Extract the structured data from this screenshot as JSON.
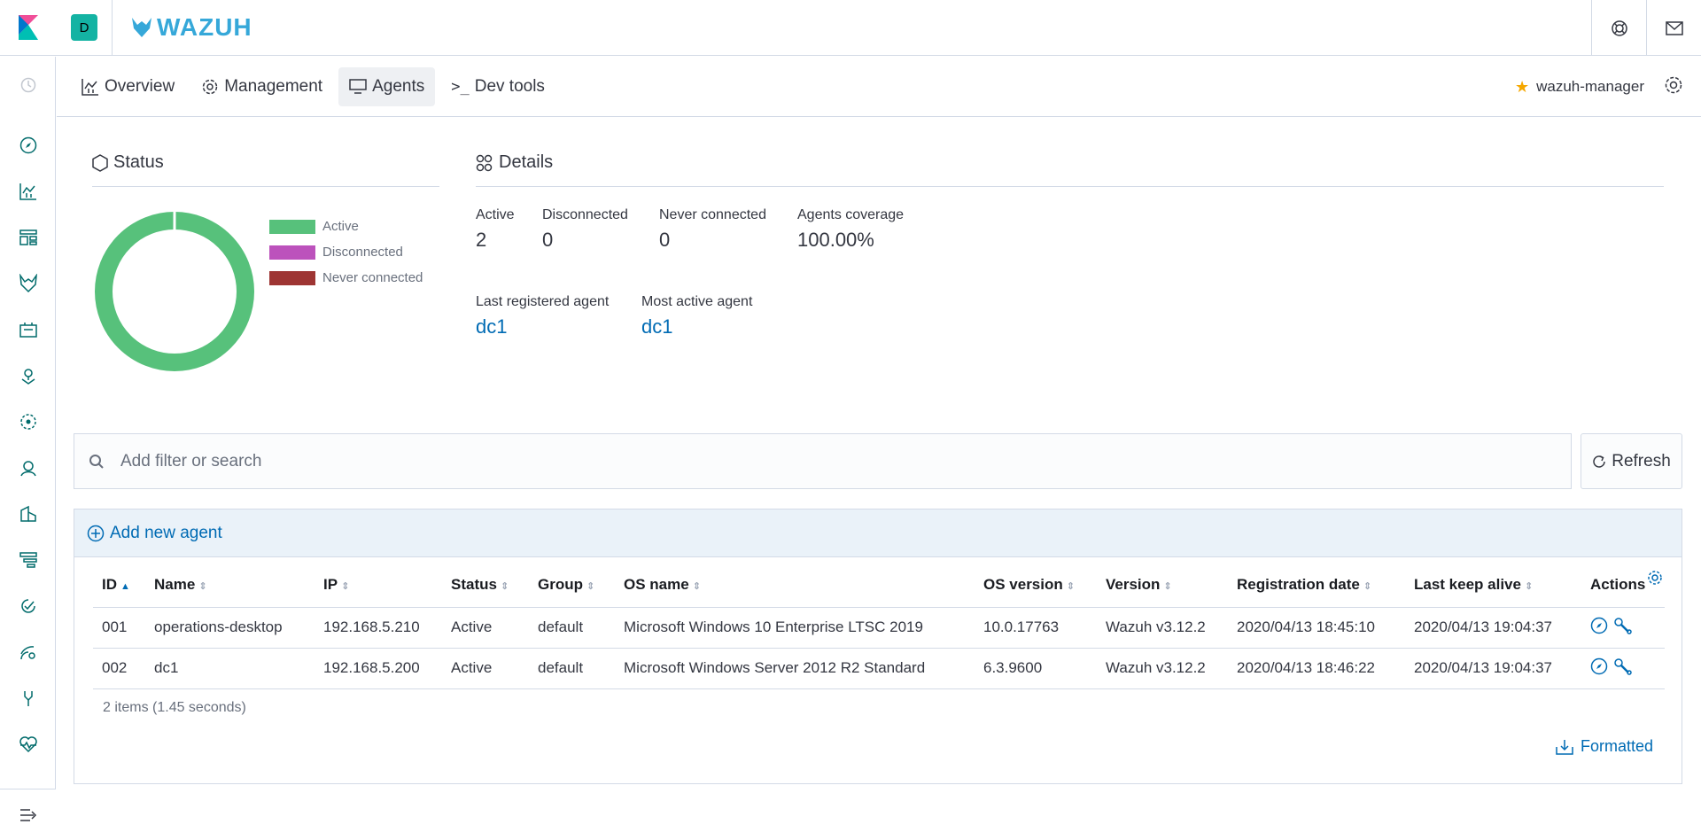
{
  "header": {
    "space_initial": "D",
    "brand": "WAZUH"
  },
  "subnav": {
    "tabs": [
      {
        "label": "Overview",
        "icon": "chart-icon"
      },
      {
        "label": "Management",
        "icon": "gear-icon"
      },
      {
        "label": "Agents",
        "icon": "monitor-icon",
        "active": true
      },
      {
        "label": "Dev tools",
        "icon": "terminal-icon"
      }
    ],
    "manager": "wazuh-manager"
  },
  "status": {
    "title": "Status",
    "legend": [
      "Active",
      "Disconnected",
      "Never connected"
    ],
    "colors": {
      "active": "#57c17b",
      "disconnected": "#bc52bc",
      "never": "#9e3533"
    },
    "counts": {
      "active": 2,
      "disconnected": 0,
      "never_connected": 0
    }
  },
  "details": {
    "title": "Details",
    "active_label": "Active",
    "active_value": "2",
    "disconnected_label": "Disconnected",
    "disconnected_value": "0",
    "never_label": "Never connected",
    "never_value": "0",
    "coverage_label": "Agents coverage",
    "coverage_value": "100.00%",
    "last_registered_label": "Last registered agent",
    "last_registered_value": "dc1",
    "most_active_label": "Most active agent",
    "most_active_value": "dc1"
  },
  "search": {
    "placeholder": "Add filter or search"
  },
  "refresh_label": "Refresh",
  "add_agent_label": "Add new agent",
  "table": {
    "columns": [
      "ID",
      "Name",
      "IP",
      "Status",
      "Group",
      "OS name",
      "OS version",
      "Version",
      "Registration date",
      "Last keep alive",
      "Actions"
    ],
    "rows": [
      [
        "001",
        "operations-desktop",
        "192.168.5.210",
        "Active",
        "default",
        "Microsoft Windows 10 Enterprise LTSC 2019",
        "10.0.17763",
        "Wazuh v3.12.2",
        "2020/04/13 18:45:10",
        "2020/04/13 19:04:37"
      ],
      [
        "002",
        "dc1",
        "192.168.5.200",
        "Active",
        "default",
        "Microsoft Windows Server 2012 R2 Standard",
        "6.3.9600",
        "Wazuh v3.12.2",
        "2020/04/13 18:46:22",
        "2020/04/13 19:04:37"
      ]
    ],
    "items_count": "2 items (1.45 seconds)",
    "formatted_label": "Formatted"
  }
}
